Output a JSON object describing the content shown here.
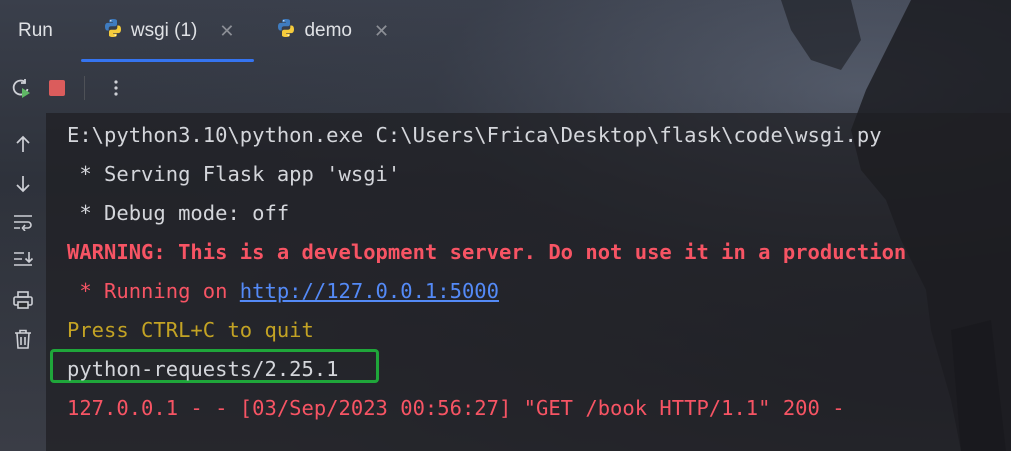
{
  "panel": {
    "title": "Run"
  },
  "tabs": [
    {
      "label": "wsgi (1)",
      "icon": "python-icon",
      "active": true
    },
    {
      "label": "demo",
      "icon": "python-icon",
      "active": false
    }
  ],
  "toolbar": {
    "rerun_icon": "rerun-icon",
    "stop_icon": "stop-icon",
    "more_icon": "more-vertical-icon"
  },
  "sidebar": {
    "icons": [
      "arrow-up-icon",
      "arrow-down-icon",
      "soft-wrap-icon",
      "scroll-to-end-icon",
      "print-icon",
      "trash-icon"
    ]
  },
  "console": {
    "command": "E:\\python3.10\\python.exe C:\\Users\\Frica\\Desktop\\flask\\code\\wsgi.py",
    "serving": " * Serving Flask app 'wsgi'",
    "debug": " * Debug mode: off",
    "warning": "WARNING: This is a development server. Do not use it in a production",
    "running_prefix": " * Running on ",
    "running_url": "http://127.0.0.1:5000",
    "quit_hint": "Press CTRL+C to quit",
    "user_agent": "python-requests/2.25.1",
    "access_log": "127.0.0.1 - - [03/Sep/2023 00:56:27] \"GET /book HTTP/1.1\" 200 -"
  },
  "colors": {
    "accent": "#3574f0",
    "error": "#f75464",
    "warning_yellow": "#c3a324",
    "link": "#548af7",
    "highlight": "#1fa63a"
  }
}
